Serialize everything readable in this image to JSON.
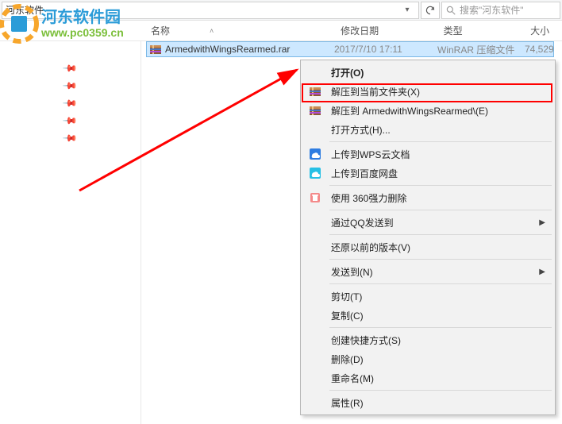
{
  "colors": {
    "selection": "#cde8ff",
    "highlight": "#ff0000"
  },
  "watermark": {
    "title": "河东软件园",
    "url": "www.pc0359.cn"
  },
  "address": {
    "crumb": "河东软件",
    "dropdown_icon": "chevron-down",
    "refresh_icon": "refresh"
  },
  "search": {
    "placeholder": "搜索\"河东软件\""
  },
  "columns": {
    "name": "名称",
    "date": "修改日期",
    "type": "类型",
    "size": "大小",
    "sort_indicator": "˄"
  },
  "nav_pins": [
    "",
    "",
    "",
    "",
    ""
  ],
  "file": {
    "icon": "rar-archive-icon",
    "name": "ArmedwithWingsRearmed.rar",
    "date": "2017/7/10  17:11",
    "type": "WinRAR 压缩文件",
    "size": "74,529"
  },
  "context_menu": {
    "items": [
      {
        "icon": null,
        "label": "打开(O)",
        "bold": true
      },
      {
        "icon": "rar-archive-icon",
        "label": "解压到当前文件夹(X)",
        "highlighted": true
      },
      {
        "icon": "rar-archive-icon",
        "label": "解压到 ArmedwithWingsRearmed\\(E)"
      },
      {
        "icon": null,
        "label": "打开方式(H)...",
        "submenu": false
      },
      {
        "sep": true
      },
      {
        "icon": "wps-cloud-icon",
        "label": "上传到WPS云文档"
      },
      {
        "icon": "baidu-pan-icon",
        "label": "上传到百度网盘"
      },
      {
        "sep": true
      },
      {
        "icon": "360-delete-icon",
        "label": "使用 360强力删除"
      },
      {
        "sep": true
      },
      {
        "icon": null,
        "label": "通过QQ发送到",
        "submenu": true
      },
      {
        "sep": true
      },
      {
        "icon": null,
        "label": "还原以前的版本(V)"
      },
      {
        "sep": true
      },
      {
        "icon": null,
        "label": "发送到(N)",
        "submenu": true
      },
      {
        "sep": true
      },
      {
        "icon": null,
        "label": "剪切(T)"
      },
      {
        "icon": null,
        "label": "复制(C)"
      },
      {
        "sep": true
      },
      {
        "icon": null,
        "label": "创建快捷方式(S)"
      },
      {
        "icon": null,
        "label": "删除(D)"
      },
      {
        "icon": null,
        "label": "重命名(M)"
      },
      {
        "sep": true
      },
      {
        "icon": null,
        "label": "属性(R)"
      }
    ]
  }
}
